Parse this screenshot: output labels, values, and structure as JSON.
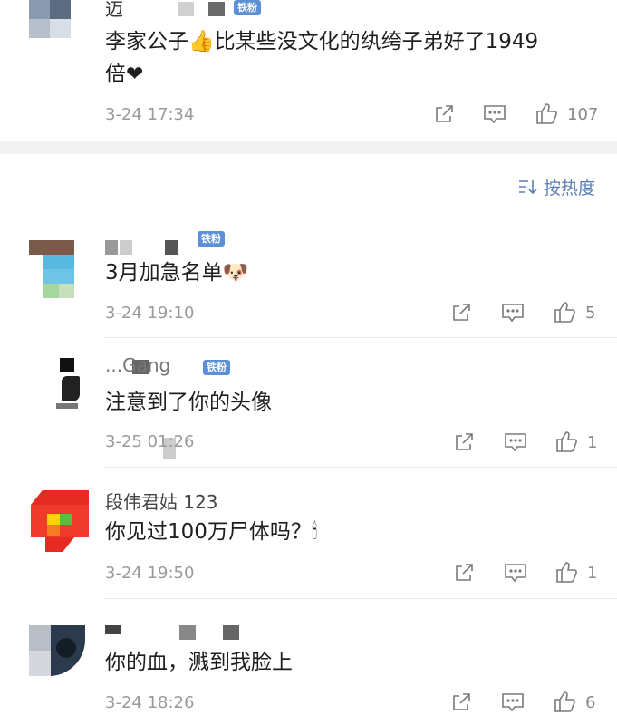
{
  "comments": [
    {
      "name": "迈",
      "badge": "铁粉",
      "text_line1": "李家公子👍比某些没文化的纨绔子弟好了1949",
      "text_line2": "倍❤",
      "time": "3-24 17:34",
      "likes": "107"
    },
    {
      "name": "",
      "badge": "铁粉",
      "text_line1": "3月加急名单🐶",
      "time": "3-24 19:10",
      "likes": "5"
    },
    {
      "name": "...Gang",
      "badge": "铁粉",
      "text_line1": "注意到了你的头像",
      "time": "3-25 01:26",
      "likes": "1"
    },
    {
      "name": "段伟君姑 123",
      "badge": "",
      "text_line1": "你见过100万尸体吗？🕯",
      "time": "3-24 19:50",
      "likes": "1"
    },
    {
      "name": "",
      "badge": "",
      "text_line1": "你的血，溅到我脸上",
      "time": "3-24 18:26",
      "likes": "6"
    }
  ],
  "sort": {
    "label": "按热度",
    "icon": "sort-icon"
  },
  "icons": {
    "share": "share-icon",
    "comment": "comment-icon",
    "like": "thumb-up-icon"
  },
  "colors": {
    "badge": "#5b8fd6",
    "sort": "#5b7eb8",
    "heart": "#e8343a"
  }
}
